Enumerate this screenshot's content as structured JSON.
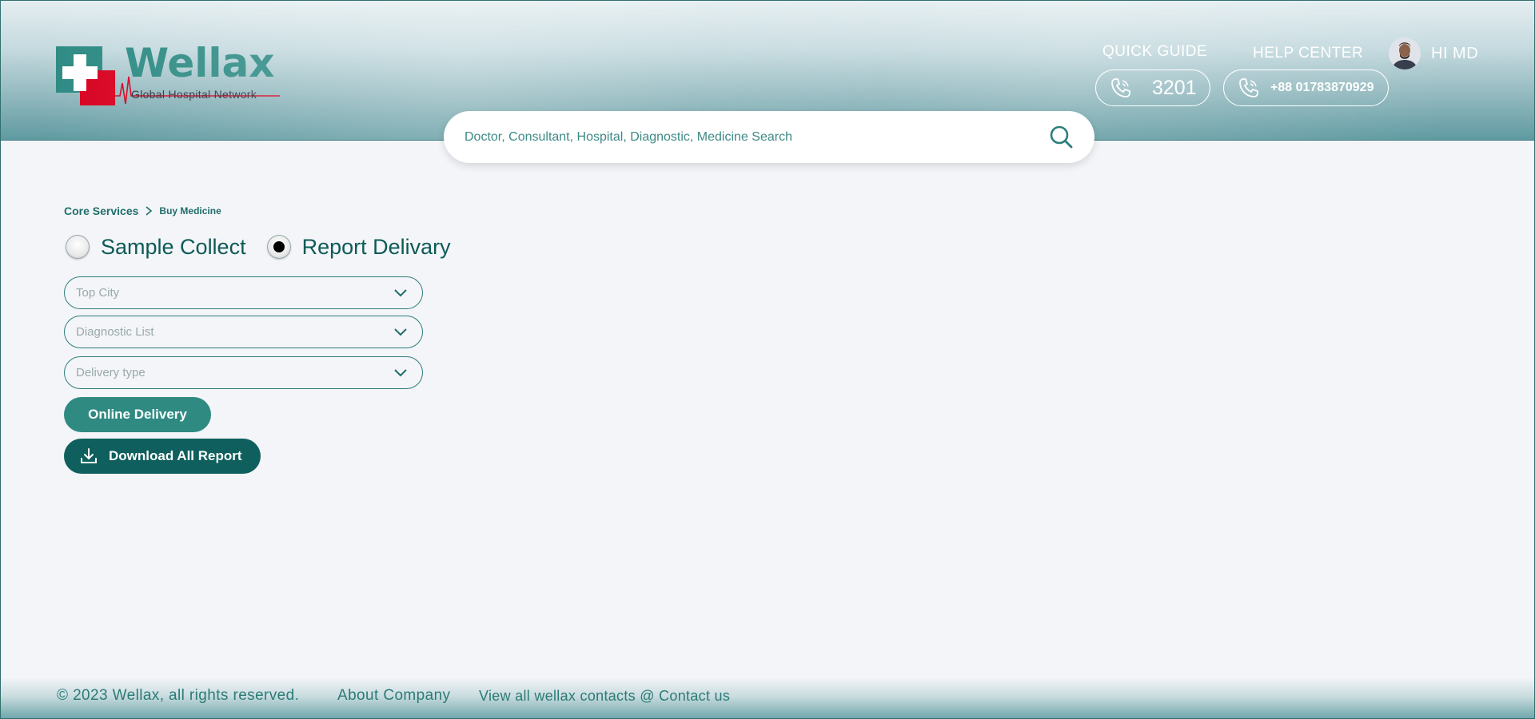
{
  "colors": {
    "brand_teal": "#2c8a83",
    "brand_red": "#d7001f",
    "dark_teal": "#0e5f5d",
    "page_bg": "#f3f5f9"
  },
  "header": {
    "logo": {
      "name": "Wellax",
      "tagline": "Global Hospital Network",
      "icon": "medical-cross-icon"
    },
    "quick_guide": {
      "label": "QUICK GUIDE",
      "number": "3201",
      "icon": "phone-icon"
    },
    "help_center": {
      "label": "HELP CENTER",
      "number": "+88 01783870929",
      "icon": "phone-icon"
    },
    "user": {
      "greeting": "HI MD",
      "avatar": "user-avatar"
    }
  },
  "search": {
    "placeholder": "Doctor, Consultant, Hospital, Diagnostic, Medicine Search",
    "value": "",
    "icon": "search-icon"
  },
  "breadcrumb": {
    "items": [
      "Core Services",
      "Buy Medicine"
    ],
    "separator_icon": "chevron-right-icon"
  },
  "service_options": {
    "options": [
      {
        "label": "Sample Collect",
        "selected": false
      },
      {
        "label": "Report Delivary",
        "selected": true
      }
    ]
  },
  "filters": {
    "top_city": {
      "placeholder": "Top City"
    },
    "diagnostic_list": {
      "placeholder": "Diagnostic List"
    },
    "delivery_type": {
      "placeholder": "Delivery type"
    }
  },
  "actions": {
    "online_delivery": "Online Delivery",
    "download_all": "Download All Report",
    "download_icon": "download-icon"
  },
  "footer": {
    "copyright": "© 2023 Wellax, all rights reserved.",
    "about": "About Company",
    "contacts": "View all wellax contacts @ Contact us"
  }
}
